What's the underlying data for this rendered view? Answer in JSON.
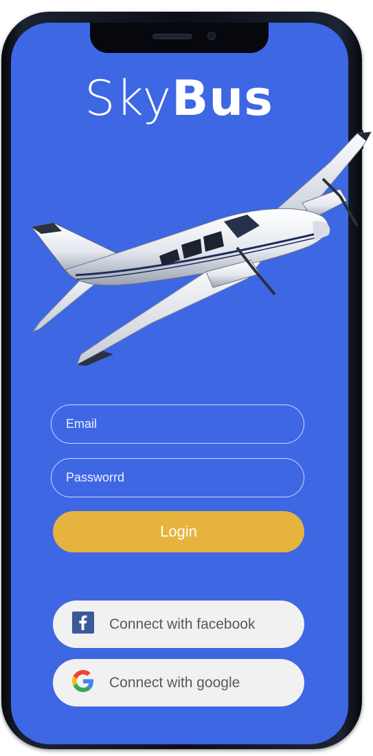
{
  "app": {
    "brand_light": "Sky",
    "brand_bold": "Bus"
  },
  "form": {
    "email_placeholder": "Email",
    "email_value": "",
    "password_placeholder": "Passworrd",
    "password_value": ""
  },
  "buttons": {
    "login_label": "Login",
    "facebook_label": "Connect with facebook",
    "google_label": "Connect with google"
  },
  "colors": {
    "screen_background": "#3e67e4",
    "login_button": "#e6b43e",
    "social_button": "#f1f1f1",
    "facebook_brand": "#3b5998"
  },
  "icons": {
    "facebook": "facebook-icon",
    "google": "google-icon",
    "airplane": "airplane-illustration"
  }
}
